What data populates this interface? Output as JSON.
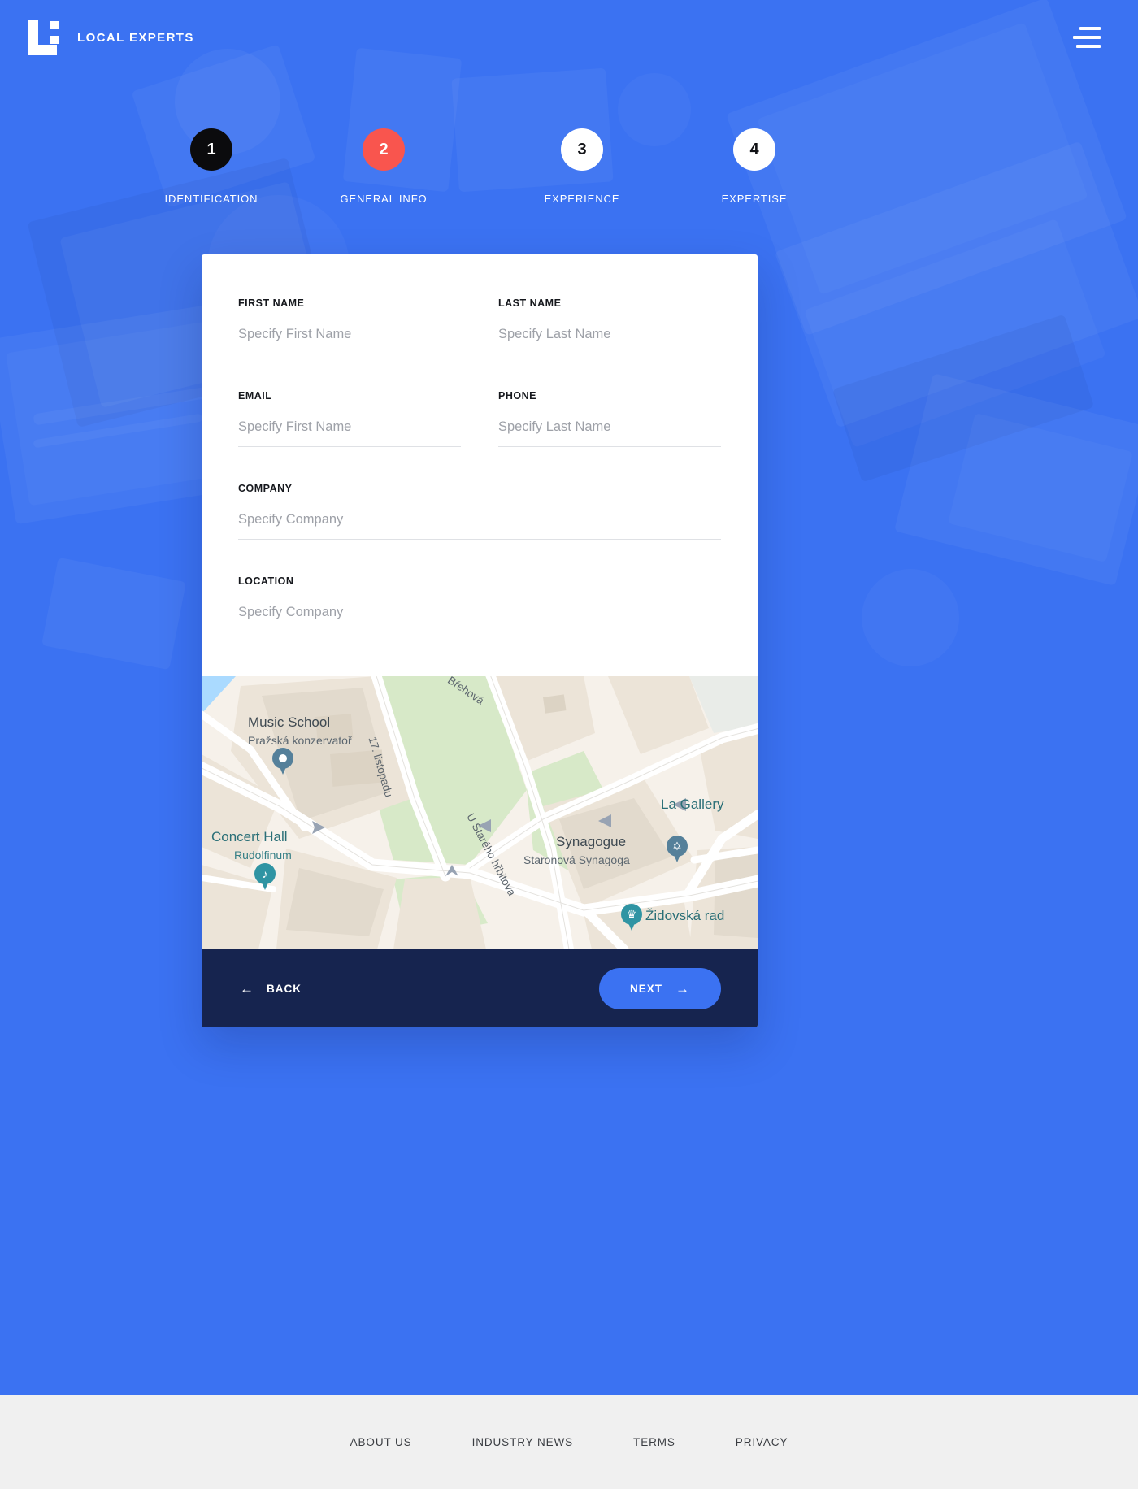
{
  "header": {
    "brand_name": "LOCAL EXPERTS",
    "logo_icon": "local-experts-logo",
    "menu_icon": "hamburger-menu-icon"
  },
  "stepper": {
    "steps": [
      {
        "number": "1",
        "label": "IDENTIFICATION",
        "state": "done"
      },
      {
        "number": "2",
        "label": "GENERAL INFO",
        "state": "active"
      },
      {
        "number": "3",
        "label": "EXPERIENCE",
        "state": "todo"
      },
      {
        "number": "4",
        "label": "EXPERTISE",
        "state": "todo"
      }
    ],
    "colors": {
      "done": "#0b0b0d",
      "active": "#f9554e",
      "todo": "#ffffff"
    }
  },
  "form": {
    "fields": [
      {
        "label": "FIRST NAME",
        "placeholder": "Specify First Name",
        "value": ""
      },
      {
        "label": "LAST NAME",
        "placeholder": "Specify Last Name",
        "value": ""
      },
      {
        "label": "EMAIL",
        "placeholder": "Specify First Name",
        "value": ""
      },
      {
        "label": "PHONE",
        "placeholder": "Specify Last Name",
        "value": ""
      },
      {
        "label": "COMPANY",
        "placeholder": "Specify Company",
        "value": ""
      },
      {
        "label": "LOCATION",
        "placeholder": "Specify Company",
        "value": ""
      }
    ]
  },
  "map": {
    "pois": [
      {
        "title": "Music School",
        "subtitle": "Pražská konzervatoř",
        "pin_icon": "map-pin-icon"
      },
      {
        "title": "Concert Hall",
        "subtitle": "Rudolfinum",
        "pin_icon": "music-note-pin-icon"
      },
      {
        "title": "Synagogue",
        "subtitle": "Staronová Synagoga",
        "pin_icon": "star-of-david-pin-icon"
      },
      {
        "title": "La Gallery",
        "subtitle": "",
        "pin_icon": ""
      },
      {
        "title": "Židovská rad",
        "subtitle": "",
        "pin_icon": "castle-pin-icon"
      }
    ],
    "streets": [
      "Břehová",
      "17. listopadu",
      "U Starého hřbitova"
    ]
  },
  "card_footer": {
    "back_label": "BACK",
    "back_icon": "arrow-left-icon",
    "next_label": "NEXT",
    "next_icon": "arrow-right-icon",
    "next_color": "#3b72f2",
    "bar_color": "#16244f"
  },
  "site_footer": {
    "links": [
      "ABOUT US",
      "INDUSTRY NEWS",
      "TERMS",
      "PRIVACY"
    ]
  },
  "theme": {
    "hero_blue": "#3b72f2",
    "accent_red": "#f9554e",
    "footer_grey": "#f0f0f0"
  }
}
